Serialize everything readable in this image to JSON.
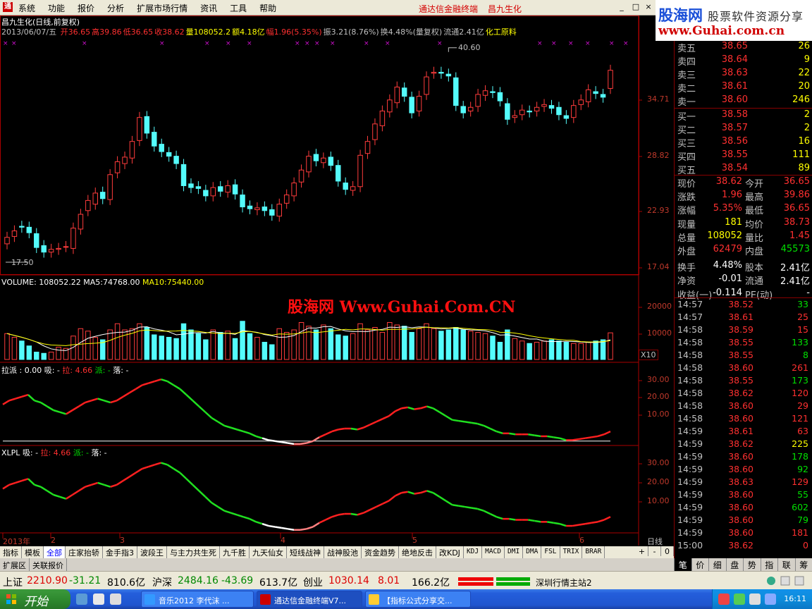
{
  "menubar": {
    "items": [
      "系统",
      "功能",
      "报价",
      "分析",
      "扩展市场行情",
      "资讯",
      "工具",
      "帮助"
    ],
    "app_title": "通达信金融终端",
    "stock_title": "昌九生化",
    "win_buttons": [
      "_",
      "□",
      "×"
    ]
  },
  "brand": {
    "line1": "股海网",
    "line2": "股票软件资源分享",
    "line3": "www.Guhai.com.cn"
  },
  "chart_header": {
    "line1": "昌九生化(日线,前复权)",
    "date": "2013/06/07/五",
    "fields": [
      {
        "k": "开",
        "v": "36.65",
        "c": "#ff3030"
      },
      {
        "k": "高",
        "v": "39.86",
        "c": "#ff3030"
      },
      {
        "k": "低",
        "v": "36.65",
        "c": "#ff3030"
      },
      {
        "k": "收",
        "v": "38.62",
        "c": "#ff3030"
      },
      {
        "k": "量",
        "v": "108052.2",
        "c": "#ffff00"
      },
      {
        "k": "额",
        "v": "4.18亿",
        "c": "#ffff00"
      },
      {
        "k": "幅",
        "v": "1.96(5.35%)",
        "c": "#ff3030"
      },
      {
        "k": "振",
        "v": "3.21(8.76%)",
        "c": "#c0c0c0"
      },
      {
        "k": "换",
        "v": "4.48%(量复权)",
        "c": "#c0c0c0"
      },
      {
        "k": "流通",
        "v": "2.41亿",
        "c": "#c0c0c0"
      },
      {
        "k": "",
        "v": "化工原料",
        "c": "#ffff00"
      }
    ]
  },
  "price_axis": [
    "34.71",
    "28.82",
    "22.93",
    "17.04"
  ],
  "price_marks": {
    "high": "40.60",
    "low": "17.50"
  },
  "volume_header": {
    "name": "VOLUME:",
    "value": "108052.22",
    "ma5_label": "MA5:",
    "ma5": "74768.00",
    "ma10_label": "MA10:",
    "ma10": "75440.00"
  },
  "volume_axis": [
    "20000",
    "10000"
  ],
  "volume_unit": "X10",
  "watermark": "股海网 Www.Guhai.Com.CN",
  "ind1_header": {
    "name": "拉派 : 0.00",
    "x": "吸: -",
    "la": "拉: 4.66",
    "pai": "派: -",
    "luo": "落: -"
  },
  "ind1_axis": [
    "30.00",
    "20.00",
    "10.00"
  ],
  "ind2_header": {
    "name": "XLPL",
    "x": "吸: -",
    "la": "拉: 4.66",
    "pai": "派: -",
    "luo": "落: -"
  },
  "ind2_axis": [
    "30.00",
    "20.00",
    "10.00"
  ],
  "date_axis": {
    "labels": [
      "2013年",
      "2",
      "3",
      "4",
      "5",
      "6"
    ],
    "period": "日线"
  },
  "chart_data": {
    "type": "candlestick",
    "dates": [
      "2013-01-04",
      "2013-06-07"
    ],
    "close_series": [
      20.5,
      21.2,
      21.6,
      21.0,
      19.4,
      18.9,
      19.2,
      19.3,
      19.5,
      21.5,
      23.0,
      24.5,
      25.3,
      24.7,
      27.3,
      28.7,
      29.2,
      30.9,
      33.5,
      31.8,
      30.4,
      29.8,
      29.3,
      28.5,
      26.1,
      25.9,
      25.8,
      25.0,
      25.9,
      25.5,
      26.1,
      25.2,
      23.8,
      23.6,
      23.7,
      23.4,
      22.9,
      24.1,
      25.1,
      26.4,
      27.8,
      29.3,
      28.8,
      29.1,
      28.3,
      26.6,
      25.7,
      26.0,
      29.4,
      30.9,
      32.8,
      34.2,
      35.4,
      36.8,
      35.8,
      34.0,
      35.8,
      37.9,
      38.4,
      38.3,
      38.0,
      34.8,
      34.0,
      34.6,
      36.0,
      36.4,
      36.2,
      35.3,
      33.3,
      33.7,
      34.3,
      34.1,
      34.6,
      34.9,
      34.5,
      33.8,
      33.4,
      34.8,
      35.4,
      36.5,
      36.1,
      35.7,
      38.62
    ],
    "open_series": [
      19.8,
      20.6,
      21.7,
      21.6,
      20.9,
      19.6,
      18.9,
      19.2,
      19.5,
      19.3,
      21.4,
      23.4,
      24.1,
      25.4,
      24.6,
      27.5,
      28.5,
      29.1,
      31.0,
      33.6,
      31.9,
      30.6,
      29.7,
      29.3,
      28.4,
      26.3,
      26.0,
      25.6,
      25.0,
      26.0,
      25.4,
      26.2,
      25.1,
      23.9,
      23.5,
      23.8,
      23.5,
      22.8,
      24.2,
      25.0,
      26.5,
      27.6,
      29.5,
      28.6,
      29.2,
      28.3,
      26.4,
      25.6,
      26.0,
      29.6,
      31.1,
      32.6,
      34.1,
      35.1,
      36.7,
      35.7,
      34.2,
      36.0,
      38.3,
      38.4,
      38.2,
      37.8,
      34.7,
      34.2,
      34.7,
      35.9,
      36.3,
      36.2,
      35.0,
      33.5,
      33.8,
      34.2,
      34.2,
      34.7,
      34.8,
      34.6,
      33.7,
      33.5,
      34.9,
      35.2,
      36.3,
      36.0,
      36.65
    ],
    "volume_series": [
      10500,
      9000,
      7500,
      5500,
      3000,
      2500,
      3000,
      5000,
      4500,
      9500,
      12500,
      11500,
      9000,
      8000,
      12000,
      14500,
      12000,
      12500,
      14500,
      13000,
      10000,
      9500,
      9000,
      8500,
      14500,
      12000,
      10500,
      8000,
      12000,
      11000,
      11500,
      8500,
      15500,
      10500,
      9000,
      7000,
      6000,
      12500,
      11000,
      12000,
      15000,
      13500,
      12000,
      14000,
      12500,
      10000,
      9500,
      10500,
      14500,
      12000,
      13000,
      11000,
      15000,
      14000,
      13500,
      11000,
      12500,
      14500,
      12500,
      11500,
      12000,
      13000,
      12000,
      11500,
      11000,
      10500,
      9500,
      7000,
      12000,
      8500,
      7500,
      6500,
      7000,
      7500,
      8000,
      7500,
      7000,
      6500,
      6500,
      7000,
      7500,
      8000,
      10805
    ],
    "ylim_price": [
      17.04,
      41.5
    ],
    "ylim_volume": [
      0,
      28000
    ],
    "indicator_series": [
      19,
      21,
      22,
      23,
      24,
      21,
      20,
      18,
      16,
      15,
      14,
      16,
      18,
      20,
      21,
      22,
      21,
      20,
      21,
      23,
      25,
      27,
      29,
      30,
      31,
      32,
      31,
      29,
      27,
      24,
      21,
      18,
      15,
      12,
      10,
      8,
      7,
      6,
      5,
      4,
      2.5,
      1.5,
      0.5,
      0,
      -0.5,
      -1,
      -1.5,
      -1.5,
      -1,
      0,
      2,
      3.5,
      5,
      6,
      6.5,
      6.5,
      6,
      7,
      8.5,
      10,
      11.5,
      13,
      15.5,
      17,
      17.5,
      16.5,
      17,
      18,
      17,
      15,
      13,
      11,
      10.5,
      10,
      9.5,
      9,
      8,
      6.5,
      5,
      4,
      4,
      3.5,
      3.5,
      3.5,
      3,
      2.5,
      2.5,
      2,
      1.5,
      0.5,
      0.5,
      1,
      1.5,
      2,
      2.5,
      3.5,
      5
    ],
    "indicator_ylim": [
      -3,
      35
    ]
  },
  "quotes": {
    "sells": [
      {
        "name": "卖五",
        "price": "38.65",
        "vol": "26"
      },
      {
        "name": "卖四",
        "price": "38.64",
        "vol": "9"
      },
      {
        "name": "卖三",
        "price": "38.63",
        "vol": "22"
      },
      {
        "name": "卖二",
        "price": "38.61",
        "vol": "20"
      },
      {
        "name": "卖一",
        "price": "38.60",
        "vol": "246"
      }
    ],
    "buys": [
      {
        "name": "买一",
        "price": "38.58",
        "vol": "2"
      },
      {
        "name": "买二",
        "price": "38.57",
        "vol": "2"
      },
      {
        "name": "买三",
        "price": "38.56",
        "vol": "16"
      },
      {
        "name": "买四",
        "price": "38.55",
        "vol": "111"
      },
      {
        "name": "买五",
        "price": "38.54",
        "vol": "89"
      }
    ]
  },
  "stats": [
    {
      "l1": "现价",
      "v1": "38.62",
      "c1": "#ff3030",
      "l2": "今开",
      "v2": "36.65",
      "c2": "#ff3030"
    },
    {
      "l1": "涨跌",
      "v1": "1.96",
      "c1": "#ff3030",
      "l2": "最高",
      "v2": "39.86",
      "c2": "#ff3030"
    },
    {
      "l1": "涨幅",
      "v1": "5.35%",
      "c1": "#ff3030",
      "l2": "最低",
      "v2": "36.65",
      "c2": "#ff3030"
    },
    {
      "l1": "现量",
      "v1": "181",
      "c1": "#ffff00",
      "l2": "均价",
      "v2": "38.73",
      "c2": "#ff3030"
    },
    {
      "l1": "总量",
      "v1": "108052",
      "c1": "#ffff00",
      "l2": "量比",
      "v2": "1.45",
      "c2": "#ff3030"
    },
    {
      "l1": "外盘",
      "v1": "62479",
      "c1": "#ff3030",
      "l2": "内盘",
      "v2": "45573",
      "c2": "#00e000"
    },
    {
      "l1": "换手",
      "v1": "4.48%",
      "c1": "#ffffff",
      "l2": "股本",
      "v2": "2.41亿",
      "c2": "#ffffff"
    },
    {
      "l1": "净资",
      "v1": "-0.01",
      "c1": "#ffffff",
      "l2": "流通",
      "v2": "2.41亿",
      "c2": "#ffffff"
    },
    {
      "l1": "收益(一)",
      "v1": "-0.114",
      "c1": "#ffffff",
      "l2": "PE(动)",
      "v2": "-",
      "c2": "#ffffff"
    }
  ],
  "ticks": [
    {
      "t": "14:57",
      "p": "38.52",
      "v": "33",
      "vc": "#00e000"
    },
    {
      "t": "14:57",
      "p": "38.61",
      "v": "25",
      "vc": "#ff3030"
    },
    {
      "t": "14:58",
      "p": "38.59",
      "v": "15",
      "vc": "#ff3030"
    },
    {
      "t": "14:58",
      "p": "38.55",
      "v": "133",
      "vc": "#00e000"
    },
    {
      "t": "14:58",
      "p": "38.55",
      "v": "8",
      "vc": "#00e000"
    },
    {
      "t": "14:58",
      "p": "38.60",
      "v": "261",
      "vc": "#ff3030"
    },
    {
      "t": "14:58",
      "p": "38.55",
      "v": "173",
      "vc": "#00e000"
    },
    {
      "t": "14:58",
      "p": "38.62",
      "v": "120",
      "vc": "#ff3030"
    },
    {
      "t": "14:58",
      "p": "38.60",
      "v": "29",
      "vc": "#ff3030"
    },
    {
      "t": "14:58",
      "p": "38.60",
      "v": "121",
      "vc": "#ff3030"
    },
    {
      "t": "14:59",
      "p": "38.61",
      "v": "63",
      "vc": "#ff3030"
    },
    {
      "t": "14:59",
      "p": "38.62",
      "v": "225",
      "vc": "#ffff00"
    },
    {
      "t": "14:59",
      "p": "38.60",
      "v": "178",
      "vc": "#00e000"
    },
    {
      "t": "14:59",
      "p": "38.60",
      "v": "92",
      "vc": "#00e000"
    },
    {
      "t": "14:59",
      "p": "38.63",
      "v": "129",
      "vc": "#ff3030"
    },
    {
      "t": "14:59",
      "p": "38.60",
      "v": "55",
      "vc": "#00e000"
    },
    {
      "t": "14:59",
      "p": "38.60",
      "v": "602",
      "vc": "#00e000"
    },
    {
      "t": "14:59",
      "p": "38.60",
      "v": "79",
      "vc": "#00e000"
    },
    {
      "t": "14:59",
      "p": "38.60",
      "v": "181",
      "vc": "#ff3030"
    },
    {
      "t": "15:00",
      "p": "38.62",
      "v": "0",
      "vc": "#ff3030"
    }
  ],
  "tabs": {
    "items": [
      "指标",
      "模板",
      "全部",
      "庄家抬轿",
      "金手指3",
      "波段王",
      "与主力共生死",
      "九千胜",
      "九天仙女",
      "短线战神",
      "战神股池",
      "资金趋势",
      "绝地反击",
      "改KDJ",
      "KDJ",
      "MACD",
      "DMI",
      "DMA",
      "FSL",
      "TRIX",
      "BRAR"
    ],
    "nav": [
      "+",
      "-",
      "0"
    ]
  },
  "ext_tabs": [
    "扩展区",
    "关联报价"
  ],
  "right_tabs": [
    "笔",
    "价",
    "细",
    "盘",
    "势",
    "指",
    "联",
    "筹"
  ],
  "status": {
    "sh_label": "上证",
    "sh_val": "2210.90",
    "sh_chg": "-31.21",
    "sh_amt": "810.6亿",
    "sz_label": "沪深",
    "sz_val": "2484.16",
    "sz_chg": "-43.69",
    "sz_amt": "613.7亿",
    "cy_label": "创业",
    "cy_val": "1030.14",
    "cy_chg": "8.01",
    "cy_amt": "166.2亿",
    "server": "深圳行情主站2"
  },
  "taskbar": {
    "start": "开始",
    "tasks": [
      "音乐2012  李代沫 ...",
      "通达信金融终端V7...",
      "【指标公式分享交..."
    ],
    "clock": "16:11"
  }
}
